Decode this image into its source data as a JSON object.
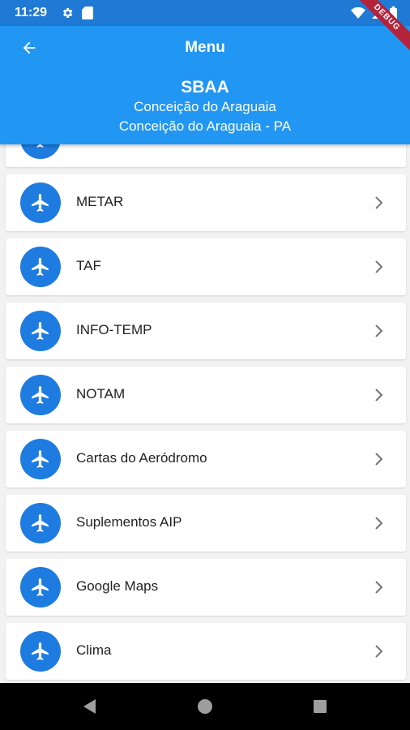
{
  "status_bar": {
    "time": "11:29",
    "icons_left": [
      "gear-icon",
      "sd-card-icon"
    ],
    "icons_right": [
      "wifi-icon",
      "signal-icon",
      "battery-icon"
    ],
    "debug_banner": "DEBUG"
  },
  "app_bar": {
    "back_icon": "arrow-back-icon",
    "title": "Menu",
    "code": "SBAA",
    "city": "Conceição do Araguaia",
    "city_state": "Conceição do Araguaia - PA"
  },
  "menu": {
    "items": [
      {
        "label": "",
        "icon": "airplane-icon"
      },
      {
        "label": "METAR",
        "icon": "airplane-icon"
      },
      {
        "label": "TAF",
        "icon": "airplane-icon"
      },
      {
        "label": "INFO-TEMP",
        "icon": "airplane-icon"
      },
      {
        "label": "NOTAM",
        "icon": "airplane-icon"
      },
      {
        "label": "Cartas do Aeródromo",
        "icon": "airplane-icon"
      },
      {
        "label": "Suplementos AIP",
        "icon": "airplane-icon"
      },
      {
        "label": "Google Maps",
        "icon": "airplane-icon"
      },
      {
        "label": "Clima",
        "icon": "airplane-icon"
      }
    ]
  },
  "nav_bar": {
    "icons": [
      "back-triangle-icon",
      "home-circle-icon",
      "recents-square-icon"
    ]
  },
  "colors": {
    "status_bar": "#1f7ad6",
    "app_bar": "#2196f3",
    "avatar": "#1e7be0",
    "debug_ribbon": "#b3243c"
  }
}
